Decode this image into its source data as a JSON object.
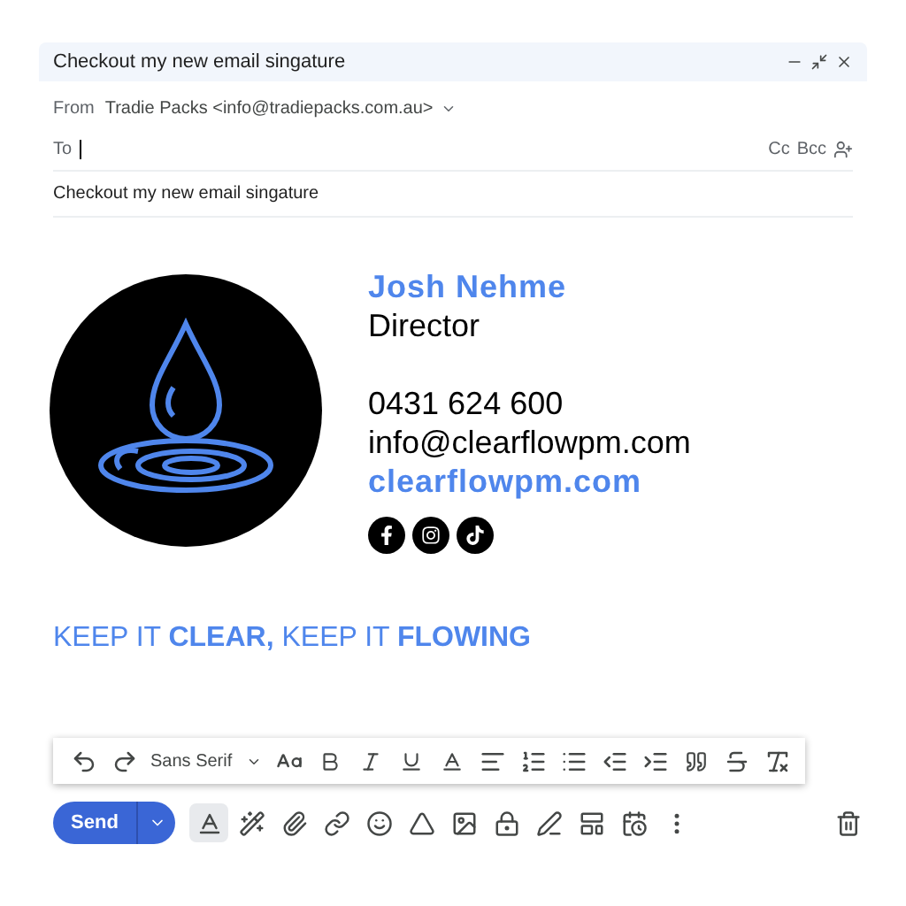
{
  "window": {
    "title": "Checkout my new email singature"
  },
  "from": {
    "label": "From",
    "value": "Tradie Packs <info@tradiepacks.com.au>"
  },
  "to": {
    "label": "To"
  },
  "recipient_options": [
    "Cc",
    "Bcc"
  ],
  "subject": {
    "value": "Checkout my new email singature"
  },
  "signature": {
    "name": "Josh Nehme",
    "role": "Director",
    "phone": "0431 624 600",
    "email": "info@clearflowpm.com",
    "website": "clearflowpm.com",
    "social": [
      {
        "kind": "facebook"
      },
      {
        "kind": "instagram"
      },
      {
        "kind": "tiktok"
      }
    ]
  },
  "tagline": "KEEP IT **CLEAR,** KEEP IT **FLOWING**",
  "format_toolbar": {
    "font": "Sans Serif"
  },
  "send_button": "Send"
}
